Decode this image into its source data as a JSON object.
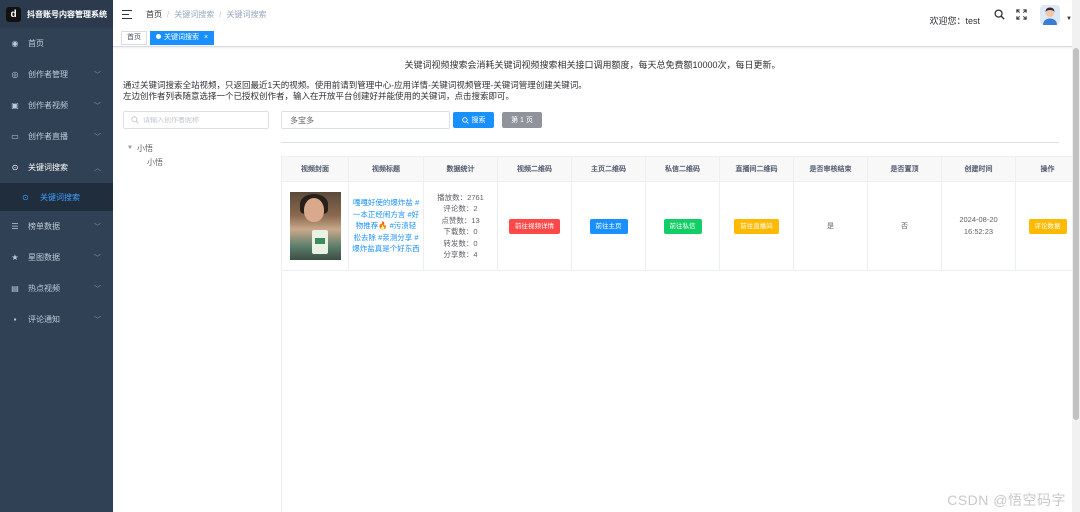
{
  "app": {
    "title": "抖音账号内容管理系统",
    "logo_glyph": "d"
  },
  "sidebar": {
    "items": [
      {
        "label": "首页",
        "icon": "dashboard-icon",
        "glyph": "◉",
        "has_children": false
      },
      {
        "label": "创作者管理",
        "icon": "user-group-icon",
        "glyph": "◎",
        "has_children": true
      },
      {
        "label": "创作者视频",
        "icon": "video-icon",
        "glyph": "▣",
        "has_children": true
      },
      {
        "label": "创作者直播",
        "icon": "monitor-icon",
        "glyph": "▭",
        "has_children": true
      },
      {
        "label": "关键词搜索",
        "icon": "search-icon",
        "glyph": "⊙",
        "has_children": true,
        "open": true
      },
      {
        "label": "榜单数据",
        "icon": "list-icon",
        "glyph": "☰",
        "has_children": true
      },
      {
        "label": "星图数据",
        "icon": "star-icon",
        "glyph": "★",
        "has_children": true
      },
      {
        "label": "热点视频",
        "icon": "fire-icon",
        "glyph": "▤",
        "has_children": true
      },
      {
        "label": "评论通知",
        "icon": "comment-icon",
        "glyph": "▪",
        "has_children": true
      }
    ],
    "sub_item": {
      "label": "关键词搜索",
      "icon": "search-icon",
      "glyph": "⊙"
    }
  },
  "header": {
    "breadcrumb": [
      "首页",
      "关键词搜索",
      "关键词搜索"
    ],
    "welcome": "欢迎您：test"
  },
  "tags": [
    {
      "label": "首页",
      "active": false
    },
    {
      "label": "关键词搜索",
      "active": true,
      "close": "×"
    }
  ],
  "main": {
    "notice": "关键词视频搜索会消耗关键词视频搜索相关接口调用额度，每天总免费额10000次，每日更新。",
    "desc_line1": "通过关键词搜索全站视频，只返回最近1天的视频。使用前请到管理中心-应用详情-关键词视频管理-关键词管理创建关键词。",
    "desc_line2": "左边创作者列表随意选择一个已授权创作者，输入在开放平台创建好并能使用的关键词，点击搜索即可。",
    "author_search": {
      "placeholder": "请输入创作者昵称"
    },
    "tree": {
      "root": "小悟",
      "child": "小悟"
    },
    "keyword_input": {
      "value": "多宝多"
    },
    "search_button": "搜索",
    "page_button": "第 1 页"
  },
  "table": {
    "columns": [
      "视频封面",
      "视频标题",
      "数据统计",
      "视频二维码",
      "主页二维码",
      "私信二维码",
      "直播间二维码",
      "是否审核结束",
      "是否置顶",
      "创建时间",
      "操作"
    ],
    "rows": [
      {
        "title": "嘎嘎好使的爆炸盐 #一本正经闹方言 #好物推荐🔥 #污渍轻松去除 #亲测分享 #爆炸盐真是个好东西",
        "stats": [
          "播放数：2761",
          "评论数：2",
          "点赞数：13",
          "下载数：0",
          "转发数：0",
          "分享数：4"
        ],
        "video_qr": "前往视频详情",
        "home_qr": "前往主页",
        "dm_qr": "前往私信",
        "live_qr": "前往直播间",
        "review_done": "是",
        "pinned": "否",
        "created_at": "2024-08-20 16:52:23",
        "action": "评论数据"
      }
    ]
  },
  "watermark": "CSDN @悟空码字",
  "colors": {
    "sidebar_bg": "#304156",
    "primary": "#1890ff",
    "danger": "#ff4949",
    "success": "#13ce66",
    "warning": "#ffba00",
    "info": "#909399"
  }
}
